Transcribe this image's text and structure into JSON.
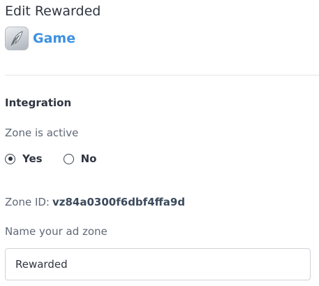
{
  "header": {
    "title": "Edit Rewarded"
  },
  "app": {
    "name": "Game",
    "icon": "game-feather-icon"
  },
  "integration": {
    "heading": "Integration",
    "zone_active_label": "Zone is active",
    "options": [
      {
        "label": "Yes",
        "selected": true
      },
      {
        "label": "No",
        "selected": false
      }
    ],
    "zone_id_label": "Zone ID:",
    "zone_id_value": "vz84a0300f6dbf4ffa9d",
    "name_label": "Name your ad zone",
    "name_value": "Rewarded"
  },
  "colors": {
    "link": "#3e91e2",
    "text": "#2f3540",
    "muted": "#5f6876",
    "border": "#cfd3d8"
  }
}
